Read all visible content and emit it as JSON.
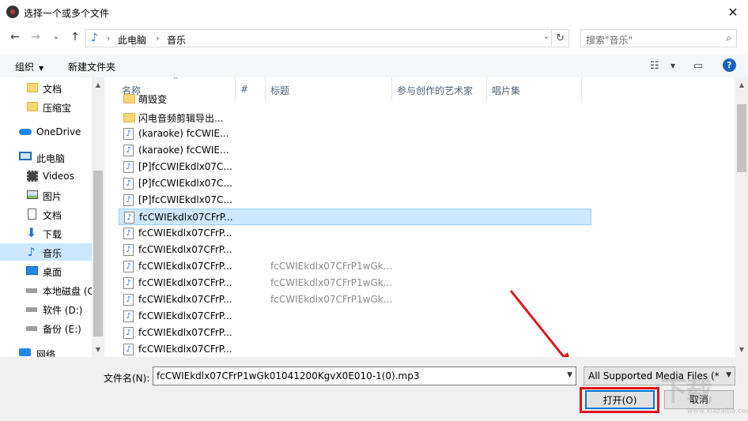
{
  "window": {
    "title": "选择一个或多个文件",
    "close_glyph": "✕"
  },
  "address": {
    "back_glyph": "←",
    "forward_glyph": "→",
    "recent_glyph": "⌄",
    "up_glyph": "↑",
    "crumbs": [
      "此电脑",
      "音乐"
    ],
    "refresh_glyph": "↻",
    "search_placeholder": "搜索\"音乐\""
  },
  "toolbar": {
    "organize": "组织",
    "new_folder": "新建文件夹",
    "help": "?"
  },
  "sidebar": {
    "items": [
      {
        "label": "文档",
        "icon": "folder-icon"
      },
      {
        "label": "压缩宝",
        "icon": "folder-icon"
      },
      {
        "label": "OneDrive",
        "icon": "cloud-icon"
      },
      {
        "label": "此电脑",
        "icon": "computer-icon"
      },
      {
        "label": "Videos",
        "icon": "film-icon"
      },
      {
        "label": "图片",
        "icon": "picture-icon"
      },
      {
        "label": "文档",
        "icon": "document-icon"
      },
      {
        "label": "下载",
        "icon": "download-icon"
      },
      {
        "label": "音乐",
        "icon": "music-icon",
        "selected": true
      },
      {
        "label": "桌面",
        "icon": "desktop-icon"
      },
      {
        "label": "本地磁盘 (C",
        "icon": "drive-icon"
      },
      {
        "label": "软件 (D:)",
        "icon": "drive-icon"
      },
      {
        "label": "备份 (E:)",
        "icon": "drive-icon"
      },
      {
        "label": "网络",
        "icon": "network-icon"
      }
    ]
  },
  "columns": [
    "名称",
    "#",
    "标题",
    "参与创作的艺术家",
    "唱片集"
  ],
  "files": [
    {
      "name": "萌毁变",
      "type": "folder",
      "title": ""
    },
    {
      "name": "闪电音频剪辑导出...",
      "type": "folder",
      "title": ""
    },
    {
      "name": "(karaoke) fcCWIE...",
      "type": "music",
      "title": ""
    },
    {
      "name": "(karaoke) fcCWIE...",
      "type": "music",
      "title": ""
    },
    {
      "name": "[P]fcCWIEkdlx07C...",
      "type": "music",
      "title": ""
    },
    {
      "name": "[P]fcCWIEkdlx07C...",
      "type": "music",
      "title": ""
    },
    {
      "name": "[P]fcCWIEkdlx07C...",
      "type": "music",
      "title": ""
    },
    {
      "name": "fcCWIEkdlx07CFrP...",
      "type": "music",
      "title": "",
      "selected": true
    },
    {
      "name": "fcCWIEkdlx07CFrP...",
      "type": "music",
      "title": ""
    },
    {
      "name": "fcCWIEkdlx07CFrP...",
      "type": "music",
      "title": ""
    },
    {
      "name": "fcCWIEkdlx07CFrP...",
      "type": "music",
      "title": "fcCWIEkdlx07CFrP1wGk..."
    },
    {
      "name": "fcCWIEkdlx07CFrP...",
      "type": "music",
      "title": "fcCWIEkdlx07CFrP1wGk..."
    },
    {
      "name": "fcCWIEkdlx07CFrP...",
      "type": "music",
      "title": "fcCWIEkdlx07CFrP1wGk..."
    },
    {
      "name": "fcCWIEkdlx07CFrP...",
      "type": "music",
      "title": ""
    },
    {
      "name": "fcCWIEkdlx07CFrP...",
      "type": "music",
      "title": ""
    },
    {
      "name": "fcCWIEkdlx07CFrP...",
      "type": "music",
      "title": ""
    }
  ],
  "footer": {
    "filename_label": "文件名(N):",
    "filename_value": "fcCWIEkdlx07CFrP1wGk01041200KgvX0E010-1(0).mp3",
    "filetype_value": "All Supported Media Files (*",
    "open_label": "打开(O)",
    "cancel_label": "取消"
  },
  "watermark": {
    "logo_text": "下载",
    "url_text": "www.xiazaiba.com"
  },
  "colors": {
    "selection": "#cce8ff",
    "accent": "#0078d7",
    "annotation": "#e0141e"
  }
}
